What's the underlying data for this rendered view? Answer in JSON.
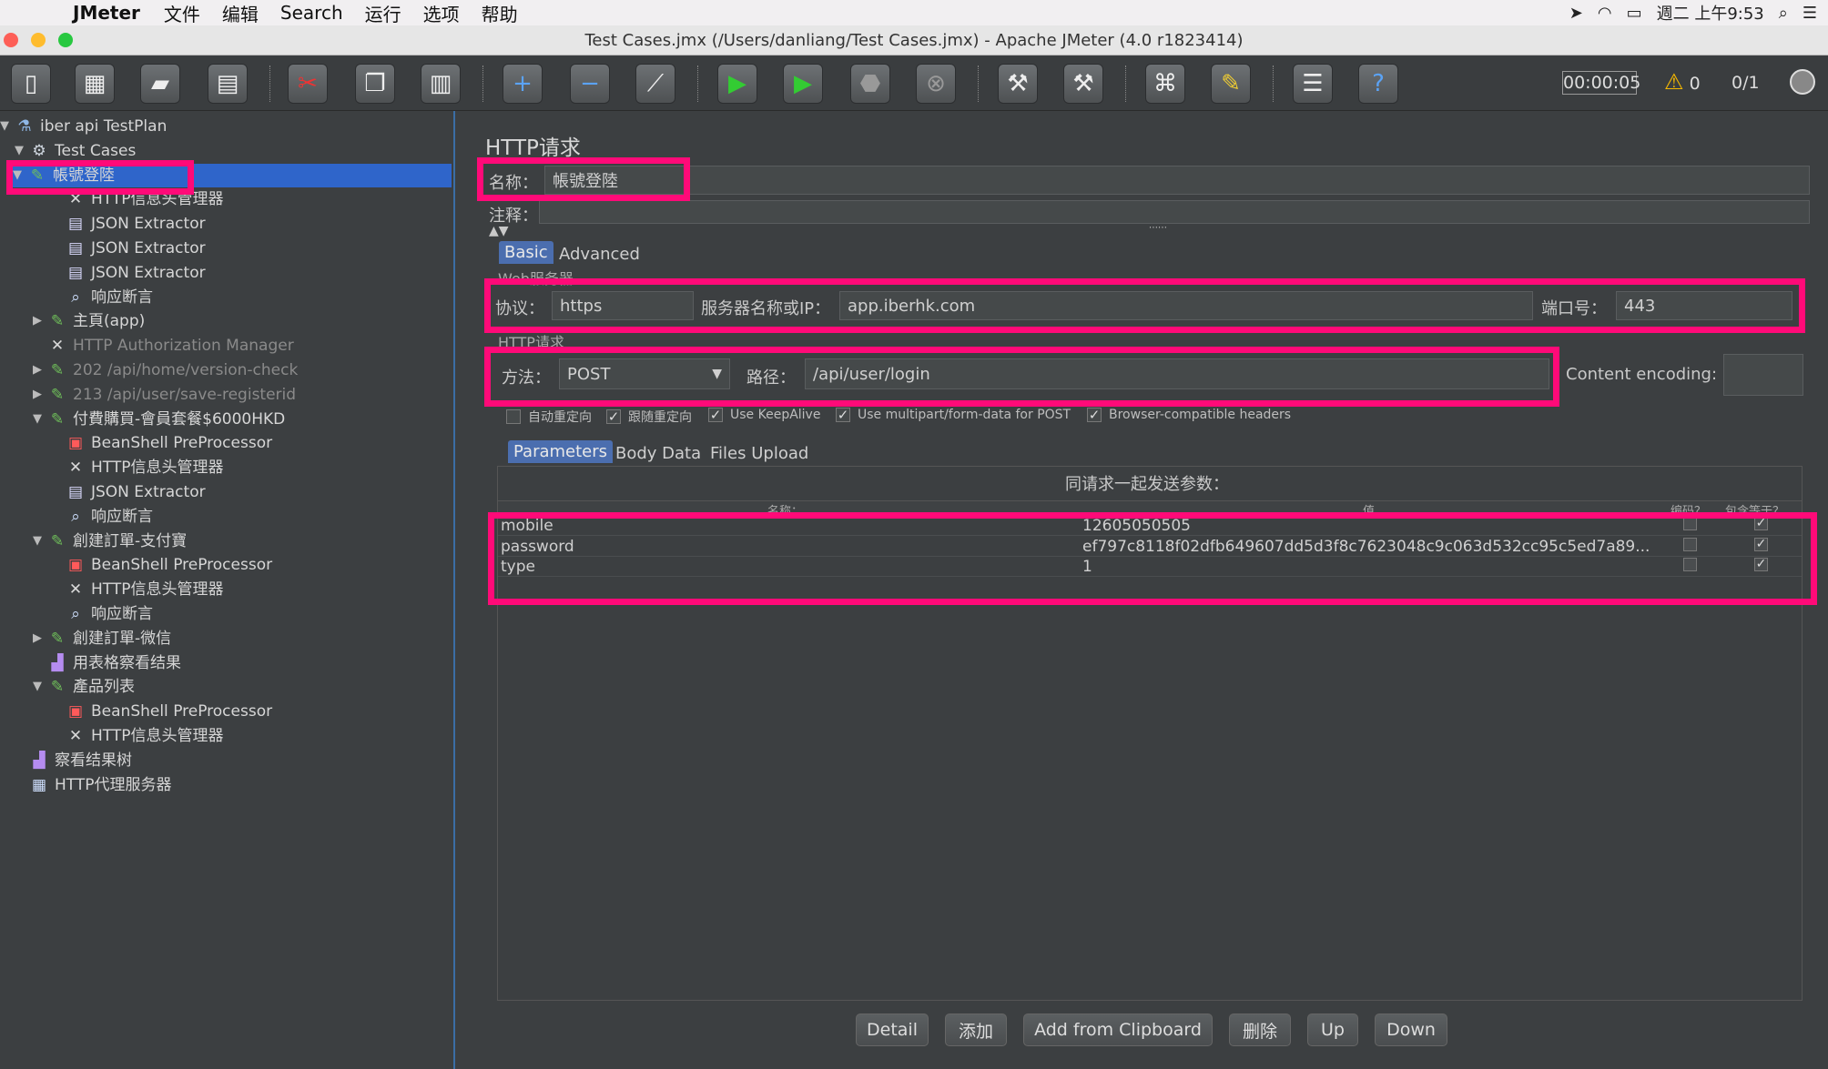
{
  "menubar": {
    "app": "JMeter",
    "items": [
      "文件",
      "编辑",
      "Search",
      "运行",
      "选项",
      "帮助"
    ],
    "clock": "週二 上午9:53"
  },
  "window": {
    "title": "Test Cases.jmx (/Users/danliang/Test Cases.jmx) - Apache JMeter (4.0 r1823414)"
  },
  "toolbar": {
    "timer": "00:00:05",
    "warnings": "0",
    "threads": "0/1"
  },
  "tree": [
    {
      "label": "iber api TestPlan",
      "icon": "flask-icon",
      "depth": 0,
      "exp": "▼"
    },
    {
      "label": "Test Cases",
      "icon": "gear-icon",
      "depth": 1,
      "exp": "▼"
    },
    {
      "label": "帳號登陸",
      "icon": "pipette-icon",
      "depth": 2,
      "exp": "▼",
      "selected": true
    },
    {
      "label": "HTTP信息头管理器",
      "icon": "tools-icon",
      "depth": 3
    },
    {
      "label": "JSON Extractor",
      "icon": "doc-icon",
      "depth": 3
    },
    {
      "label": "JSON Extractor",
      "icon": "doc-icon",
      "depth": 3
    },
    {
      "label": "JSON Extractor",
      "icon": "doc-icon",
      "depth": 3
    },
    {
      "label": "响应断言",
      "icon": "magnifier-icon",
      "depth": 3
    },
    {
      "label": "主頁(app)",
      "icon": "pipette-icon",
      "depth": 2,
      "exp": "▶"
    },
    {
      "label": "HTTP Authorization Manager",
      "icon": "tools-icon",
      "depth": 2,
      "disabled": true
    },
    {
      "label": "202 /api/home/version-check",
      "icon": "pipette-icon",
      "depth": 2,
      "exp": "▶",
      "disabled": true
    },
    {
      "label": "213 /api/user/save-registerid",
      "icon": "pipette-icon",
      "depth": 2,
      "exp": "▶",
      "disabled": true
    },
    {
      "label": "付費購買-會員套餐$6000HKD",
      "icon": "pipette-icon",
      "depth": 2,
      "exp": "▼"
    },
    {
      "label": "BeanShell PreProcessor",
      "icon": "bean-icon",
      "depth": 3
    },
    {
      "label": "HTTP信息头管理器",
      "icon": "tools-icon",
      "depth": 3
    },
    {
      "label": "JSON Extractor",
      "icon": "doc-icon",
      "depth": 3
    },
    {
      "label": "响应断言",
      "icon": "magnifier-icon",
      "depth": 3
    },
    {
      "label": "創建訂單-支付寶",
      "icon": "pipette-icon",
      "depth": 2,
      "exp": "▼"
    },
    {
      "label": "BeanShell PreProcessor",
      "icon": "bean-icon",
      "depth": 3
    },
    {
      "label": "HTTP信息头管理器",
      "icon": "tools-icon",
      "depth": 3
    },
    {
      "label": "响应断言",
      "icon": "magnifier-icon",
      "depth": 3
    },
    {
      "label": "創建訂單-微信",
      "icon": "pipette-icon",
      "depth": 2,
      "exp": "▶"
    },
    {
      "label": "用表格察看结果",
      "icon": "chart-icon",
      "depth": 2
    },
    {
      "label": "產品列表",
      "icon": "pipette-icon",
      "depth": 2,
      "exp": "▼"
    },
    {
      "label": "BeanShell PreProcessor",
      "icon": "bean-icon",
      "depth": 3
    },
    {
      "label": "HTTP信息头管理器",
      "icon": "tools-icon",
      "depth": 3
    },
    {
      "label": "察看结果树",
      "icon": "chart-icon",
      "depth": 1
    },
    {
      "label": "HTTP代理服务器",
      "icon": "proxy-icon",
      "depth": 1
    }
  ],
  "panel": {
    "title": "HTTP请求",
    "name_label": "名称：",
    "name_value": "帳號登陸",
    "comment_label": "注释：",
    "tabs": [
      "Basic",
      "Advanced"
    ],
    "web_server_label": "Web服务器",
    "protocol_label": "协议：",
    "protocol_value": "https",
    "server_label": "服务器名称或IP：",
    "server_value": "app.iberhk.com",
    "port_label": "端口号：",
    "port_value": "443",
    "http_request_label": "HTTP请求",
    "method_label": "方法：",
    "method_value": "POST",
    "path_label": "路径：",
    "path_value": "/api/user/login",
    "encoding_label": "Content encoding:",
    "checkboxes": [
      {
        "label": "自动重定向",
        "checked": false
      },
      {
        "label": "跟随重定向",
        "checked": true
      },
      {
        "label": "Use KeepAlive",
        "checked": true
      },
      {
        "label": "Use multipart/form-data for POST",
        "checked": true
      },
      {
        "label": "Browser-compatible headers",
        "checked": true
      }
    ],
    "subtabs": [
      "Parameters",
      "Body Data",
      "Files Upload"
    ],
    "params_caption": "同请求一起发送参数：",
    "columns": [
      "名称：",
      "值",
      "编码？",
      "包含等于？"
    ],
    "params": [
      {
        "name": "mobile",
        "value": "12605050505",
        "encode": false,
        "include_equals": true
      },
      {
        "name": "password",
        "value": "ef797c8118f02dfb649607dd5d3f8c7623048c9c063d532cc95c5ed7a89...",
        "encode": false,
        "include_equals": true
      },
      {
        "name": "type",
        "value": "1",
        "encode": false,
        "include_equals": true
      }
    ],
    "buttons": [
      "Detail",
      "添加",
      "Add from Clipboard",
      "删除",
      "Up",
      "Down"
    ]
  },
  "colors": {
    "highlight": "#ff0a78",
    "selection": "#2f65ca",
    "background": "#3c3f41"
  }
}
